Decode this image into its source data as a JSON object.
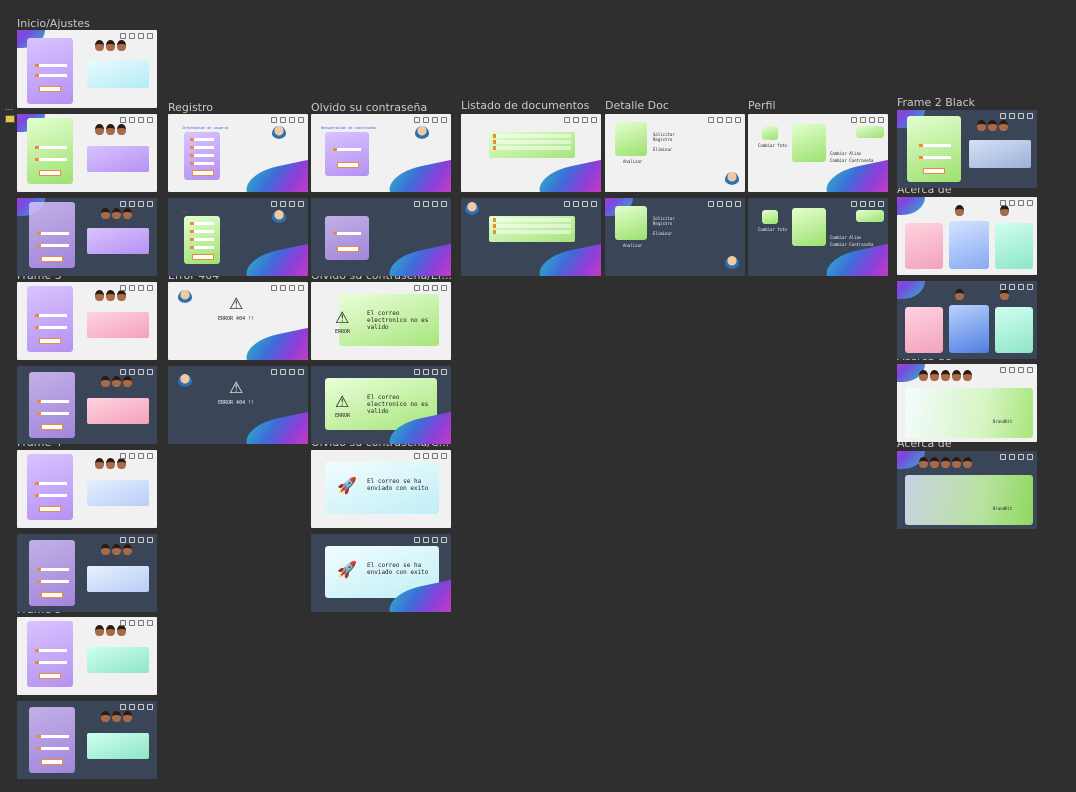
{
  "canvas": {
    "labels": {
      "inicio_ajustes": "Inicio/Ajustes",
      "registro": "Registro",
      "olvido": "Olvido su contraseña",
      "listado": "Listado de documentos",
      "detalle": "Detalle Doc",
      "perfil": "Perfil",
      "frame2black": "Frame 2 Black",
      "acerca1": "Acerca de",
      "frame3": "Frame 3",
      "error404": "Error 404",
      "olvido_error": "Olvido su contraseña/Er...",
      "acerca2": "Acerca de",
      "frame4": "Frame 4",
      "olvido_ok": "Olvido su contraseña/C...",
      "acerca3": "Acerca de",
      "frame5": "Frame 5"
    },
    "frame_text": {
      "error_404": "ERROR 404 !!",
      "error_word": "ERROR",
      "email_invalid": "El correo electronico no es valido",
      "email_sent": "El correo se ha enviado con exito",
      "recuperacion": "Recuperación de contraseña",
      "info_usuario": "Información de usuario",
      "registrar": "Registrar",
      "siguiente": "Siguiente",
      "solicitar": "Solicitar Registro",
      "eliminar": "Eliminar",
      "analizar": "Analizar",
      "cambiar_foto": "Cambiar foto",
      "cambiar_alias": "Cambiar Alias",
      "cambiar_contrasena": "Cambiar Contraseña",
      "brandkit": "BrandKit"
    },
    "icons": [
      "settings-icon",
      "help-icon",
      "user-icon",
      "logout-icon",
      "warning-icon",
      "rocket-icon",
      "github-icon"
    ],
    "colors": {
      "canvas_bg": "#2f2f2f",
      "light_frame": "#f1f1f1",
      "dark_frame": "#3a4558",
      "accent_orange": "#ef8a3a",
      "wave_start": "#2ab6c8",
      "wave_end": "#e43bb6"
    }
  }
}
